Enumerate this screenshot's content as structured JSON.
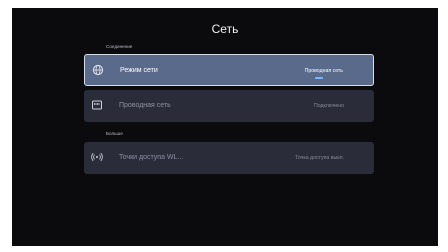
{
  "screen": {
    "title": "Сеть"
  },
  "sections": {
    "connection_label": "Соединение",
    "more_label": "Больше"
  },
  "rows": [
    {
      "label": "Режим сети",
      "value": "Проводная сеть",
      "icon": "globe-icon"
    },
    {
      "label": "Проводная сеть",
      "value": "Подключено",
      "icon": "ethernet-icon"
    },
    {
      "label": "Точки доступа WL...",
      "value": "Точка доступа выкл.",
      "icon": "wireless-icon"
    }
  ],
  "colors": {
    "background": "#0b0b0e",
    "row": "#2b2c3a",
    "focused_row": "#5a6a8a",
    "focus_border": "#d9dde5",
    "indicator": "#79b7ff"
  }
}
